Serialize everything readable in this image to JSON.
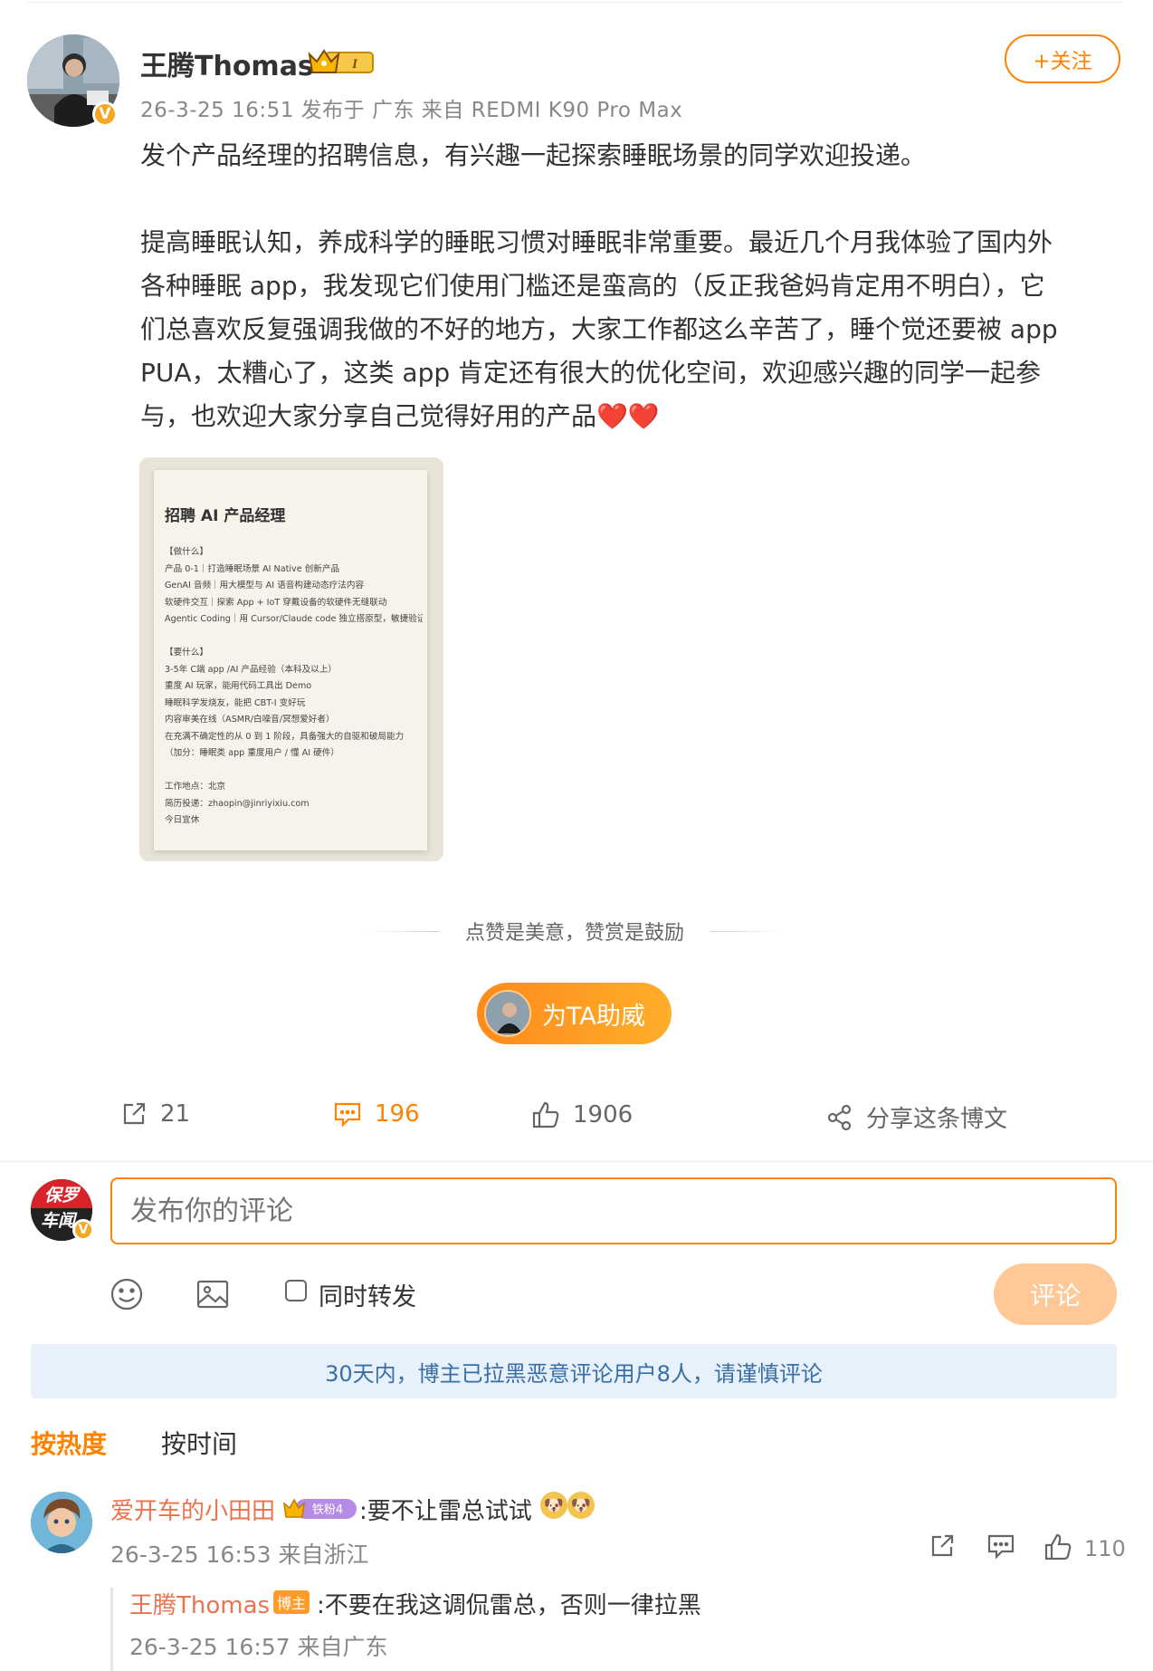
{
  "author": {
    "name": "王腾Thomas",
    "level_badge": "I",
    "verified_mark": "V",
    "meta": "26-3-25 16:51  发布于 广东  来自 REDMI K90 Pro Max",
    "follow_label": "+关注"
  },
  "post": {
    "line1": "发个产品经理的招聘信息，有兴趣一起探索睡眠场景的同学欢迎投递。",
    "para2": [
      "提高睡眠认知，养成科学的睡眠习惯对睡眠非常重要。最近几个月我体验了国内外",
      "各种睡眠 app，我发现它们使用门槛还是蛮高的（反正我爸妈肯定用不明白），它",
      "们总喜欢反复强调我做的不好的地方，大家工作都这么辛苦了，睡个觉还要被 app",
      "PUA，太糟心了，这类 app 肯定还有很大的优化空间，欢迎感兴趣的同学一起参",
      "与，也欢迎大家分享自己觉得好用的产品"
    ],
    "hearts": "❤️❤️"
  },
  "image_card": {
    "title": "招聘 AI 产品经理",
    "lines": [
      "【做什么】",
      "产品 0-1｜打造睡眠场景 AI Native 创新产品",
      "GenAI 音频｜用大模型与 AI 语音构建动态疗法内容",
      "软硬件交互｜探索 App + IoT 穿戴设备的软硬件无缝联动",
      "Agentic Coding｜用 Cursor/Claude code 独立搭原型，敏捷验证",
      "",
      "【要什么】",
      "3-5年 C端 app /AI 产品经验（本科及以上）",
      "重度 AI 玩家，能用代码工具出 Demo",
      "睡眠科学发烧友，能把 CBT-I 变好玩",
      "内容审美在线（ASMR/白噪音/冥想爱好者）",
      "在充满不确定性的从 0 到 1 阶段，具备强大的自驱和破局能力",
      "（加分：睡眠类 app 重度用户 / 懂 AI 硬件）",
      "",
      "工作地点：北京",
      "简历投递：zhaopin@jinriyixiu.com",
      "今日宜休"
    ]
  },
  "reward": {
    "divider_text": "点赞是美意，赞赏是鼓励",
    "button_label": "为TA助威"
  },
  "actions": {
    "repost_count": "21",
    "comment_count": "196",
    "like_count": "1906",
    "share_label": "分享这条博文"
  },
  "composer": {
    "avatar_text_top": "保罗",
    "avatar_text_bottom": "车闻",
    "placeholder": "发布你的评论",
    "repost_checkbox_label": "同时转发",
    "submit_label": "评论"
  },
  "notice": "30天内，博主已拉黑恶意评论用户8人，请谨慎评论",
  "sort": {
    "hot_label": "按热度",
    "time_label": "按时间"
  },
  "comments": [
    {
      "user": "爱开车的小田田",
      "fan_badge": "铁粉4",
      "text": ":要不让雷总试试",
      "emoji": "🐶",
      "meta": "26-3-25 16:53 来自浙江",
      "likes": "110",
      "reply": {
        "user": "王腾Thomas",
        "badge": "博主",
        "text": ":不要在我这调侃雷总，否则一律拉黑",
        "meta": "26-3-25 16:57 来自广东"
      }
    }
  ],
  "colors": {
    "accent": "#ff8200",
    "username_link": "#eb7350",
    "notice_bg": "#e6f1fb",
    "notice_text": "#3a6ea5"
  }
}
